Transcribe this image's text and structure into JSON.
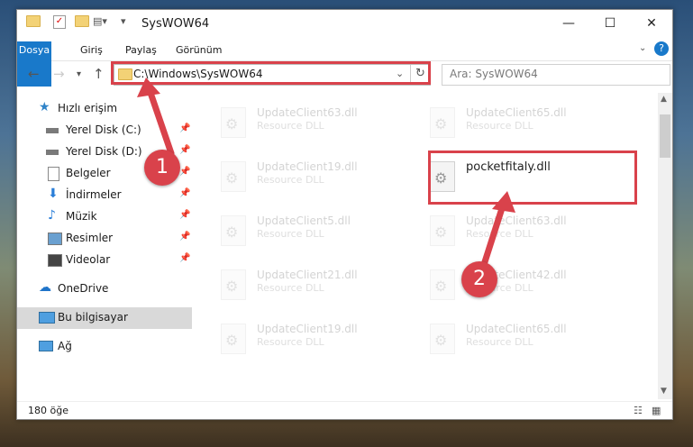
{
  "window": {
    "title": "SysWOW64"
  },
  "ribbon": {
    "tabs": [
      "Dosya",
      "Giriş",
      "Paylaş",
      "Görünüm"
    ]
  },
  "address": {
    "path": "C:\\Windows\\SysWOW64",
    "search_placeholder": "Ara: SysWOW64"
  },
  "sidebar": {
    "items": [
      {
        "label": "Hızlı erişim",
        "icon": "star-icon"
      },
      {
        "label": "Yerel Disk (C:)",
        "icon": "drive-icon",
        "pinned": true
      },
      {
        "label": "Yerel Disk (D:)",
        "icon": "drive-icon",
        "pinned": true
      },
      {
        "label": "Belgeler",
        "icon": "documents-icon",
        "pinned": true
      },
      {
        "label": "İndirmeler",
        "icon": "download-icon",
        "pinned": true
      },
      {
        "label": "Müzik",
        "icon": "music-icon",
        "pinned": true
      },
      {
        "label": "Resimler",
        "icon": "pictures-icon",
        "pinned": true
      },
      {
        "label": "Videolar",
        "icon": "videos-icon",
        "pinned": true
      },
      {
        "label": "OneDrive",
        "icon": "cloud-icon"
      },
      {
        "label": "Bu bilgisayar",
        "icon": "computer-icon",
        "selected": true
      },
      {
        "label": "Ağ",
        "icon": "network-icon"
      }
    ]
  },
  "files": [
    {
      "name": "UpdateClient63.dll",
      "desc": "Resource DLL"
    },
    {
      "name": "UpdateClient65.dll",
      "desc": "Resource DLL"
    },
    {
      "name": "UpdateClient19.dll",
      "desc": "Resource DLL"
    },
    {
      "name": "pocketfitaly.dll",
      "desc": ""
    },
    {
      "name": "UpdateClient5.dll",
      "desc": "Resource DLL"
    },
    {
      "name": "UpdateClient63.dll",
      "desc": "Resource DLL"
    },
    {
      "name": "UpdateClient21.dll",
      "desc": "Resource DLL"
    },
    {
      "name": "UpdateClient42.dll",
      "desc": "Resource DLL"
    },
    {
      "name": "UpdateClient19.dll",
      "desc": "Resource DLL"
    },
    {
      "name": "UpdateClient65.dll",
      "desc": "Resource DLL"
    }
  ],
  "status": {
    "count": "180 öğe"
  },
  "annotations": {
    "step1": "1",
    "step2": "2",
    "color": "#d9424b"
  }
}
